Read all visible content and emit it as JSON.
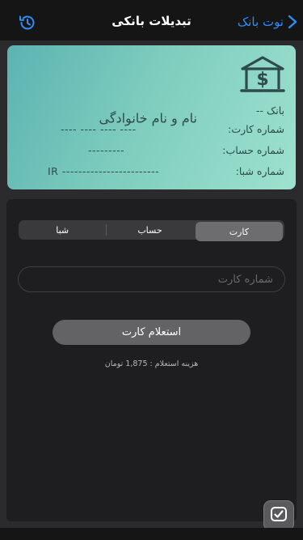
{
  "nav": {
    "title": "تبدیلات بانکی",
    "back_label": "نوت بانک",
    "history_icon": "history-icon",
    "back_icon": "chevron-right-icon"
  },
  "card": {
    "holder_name": "نام و نام خانوادگی",
    "bank_name": "بانک --",
    "logo_icon": "bank-icon",
    "rows": [
      {
        "label": "شماره کارت:",
        "value": "---- ---- ---- ----"
      },
      {
        "label": "شماره حساب:",
        "value": "---------"
      },
      {
        "label": "شماره شبا:",
        "value": "IR ------------------------"
      }
    ]
  },
  "tabs": {
    "items": [
      "کارت",
      "حساب",
      "شبا"
    ],
    "selected": "کارت"
  },
  "input": {
    "placeholder": "شماره کارت",
    "value": ""
  },
  "inquiry_button": "استعلام کارت",
  "fee_text": "هزینه استعلام : 1,875 تومان",
  "colors": {
    "accent": "#2f8df5",
    "card_gradient_start": "#5cb3b2",
    "card_gradient_end": "#9ee1cf",
    "background": "#2b2b2d",
    "panel": "#1e1e20"
  }
}
